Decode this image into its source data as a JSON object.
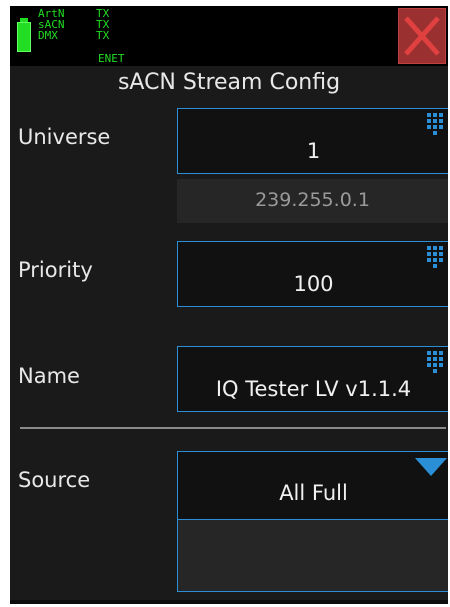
{
  "status": {
    "rows": [
      {
        "proto": "ArtN",
        "state": "TX"
      },
      {
        "proto": "sACN",
        "state": "TX"
      },
      {
        "proto": "DMX",
        "state": "TX"
      }
    ],
    "enet": "ENET",
    "color": "#22dd22"
  },
  "title": "sACN Stream Config",
  "fields": {
    "universe": {
      "label": "Universe",
      "value": "1",
      "address": "239.255.0.1",
      "icon": "keypad-icon"
    },
    "priority": {
      "label": "Priority",
      "value": "100",
      "icon": "keypad-icon"
    },
    "name": {
      "label": "Name",
      "value": "IQ Tester LV v1.1.4",
      "icon": "keypad-icon"
    },
    "source": {
      "label": "Source",
      "value": "All Full",
      "icon": "dropdown-triangle-icon"
    }
  },
  "colors": {
    "accent": "#2a8fd6",
    "close": "#9a3030",
    "background": "#1a1a1a"
  }
}
